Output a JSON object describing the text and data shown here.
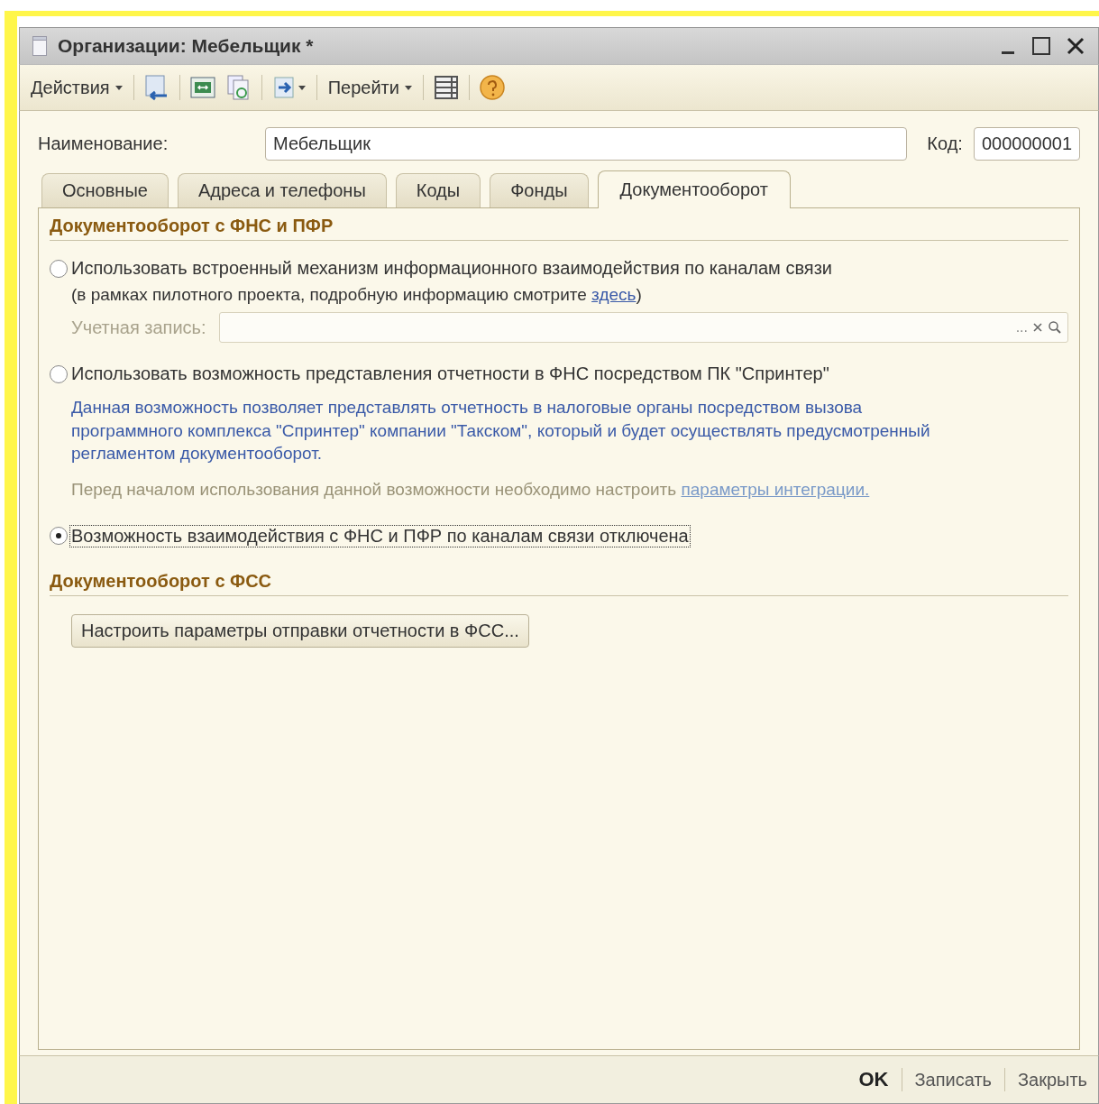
{
  "window": {
    "title": "Организации: Мебельщик *"
  },
  "toolbar": {
    "actions_menu": "Действия",
    "goto_menu": "Перейти"
  },
  "name_field": {
    "label": "Наименование:",
    "value": "Мебельщик"
  },
  "code_field": {
    "label": "Код:",
    "value": "000000001"
  },
  "tabs": [
    {
      "label": "Основные",
      "selected": false
    },
    {
      "label": "Адреса и телефоны",
      "selected": false
    },
    {
      "label": "Коды",
      "selected": false
    },
    {
      "label": "Фонды",
      "selected": false
    },
    {
      "label": "Документооборот",
      "selected": true
    }
  ],
  "fns_section": {
    "heading": "Документооборот с ФНС и ПФР",
    "options": [
      {
        "label": "Использовать встроенный механизм информационного взаимодействия по каналам связи",
        "selected": false,
        "focused": false
      },
      {
        "label": "Использовать возможность представления отчетности в ФНС посредством ПК \"Спринтер\"",
        "selected": false,
        "focused": false
      },
      {
        "label": "Возможность взаимодействия с ФНС и ПФР по каналам связи отключена",
        "selected": true,
        "focused": true
      }
    ],
    "pilot_note": {
      "text": "(в рамках пилотного проекта, подробную информацию смотрите ",
      "link": "здесь",
      "after": ")"
    },
    "account_field": {
      "label": "Учетная запись:",
      "disabled": true,
      "select_button": "..."
    },
    "sprinter_description": "Данная возможность позволяет представлять отчетность в налоговые органы посредством вызова программного комплекса \"Спринтер\" компании \"Такском\", который и будет осуществлять предусмотренный регламентом документооборот.",
    "integration_note": {
      "text": "Перед началом использования данной возможности необходимо настроить ",
      "link": "параметры интеграции."
    }
  },
  "fss_section": {
    "heading": "Документооборот с ФСС",
    "button": "Настроить параметры отправки отчетности в ФСС..."
  },
  "footer_buttons": [
    {
      "label": "OK",
      "default": true
    },
    {
      "label": "Записать",
      "default": false
    },
    {
      "label": "Закрыть",
      "default": false
    }
  ]
}
